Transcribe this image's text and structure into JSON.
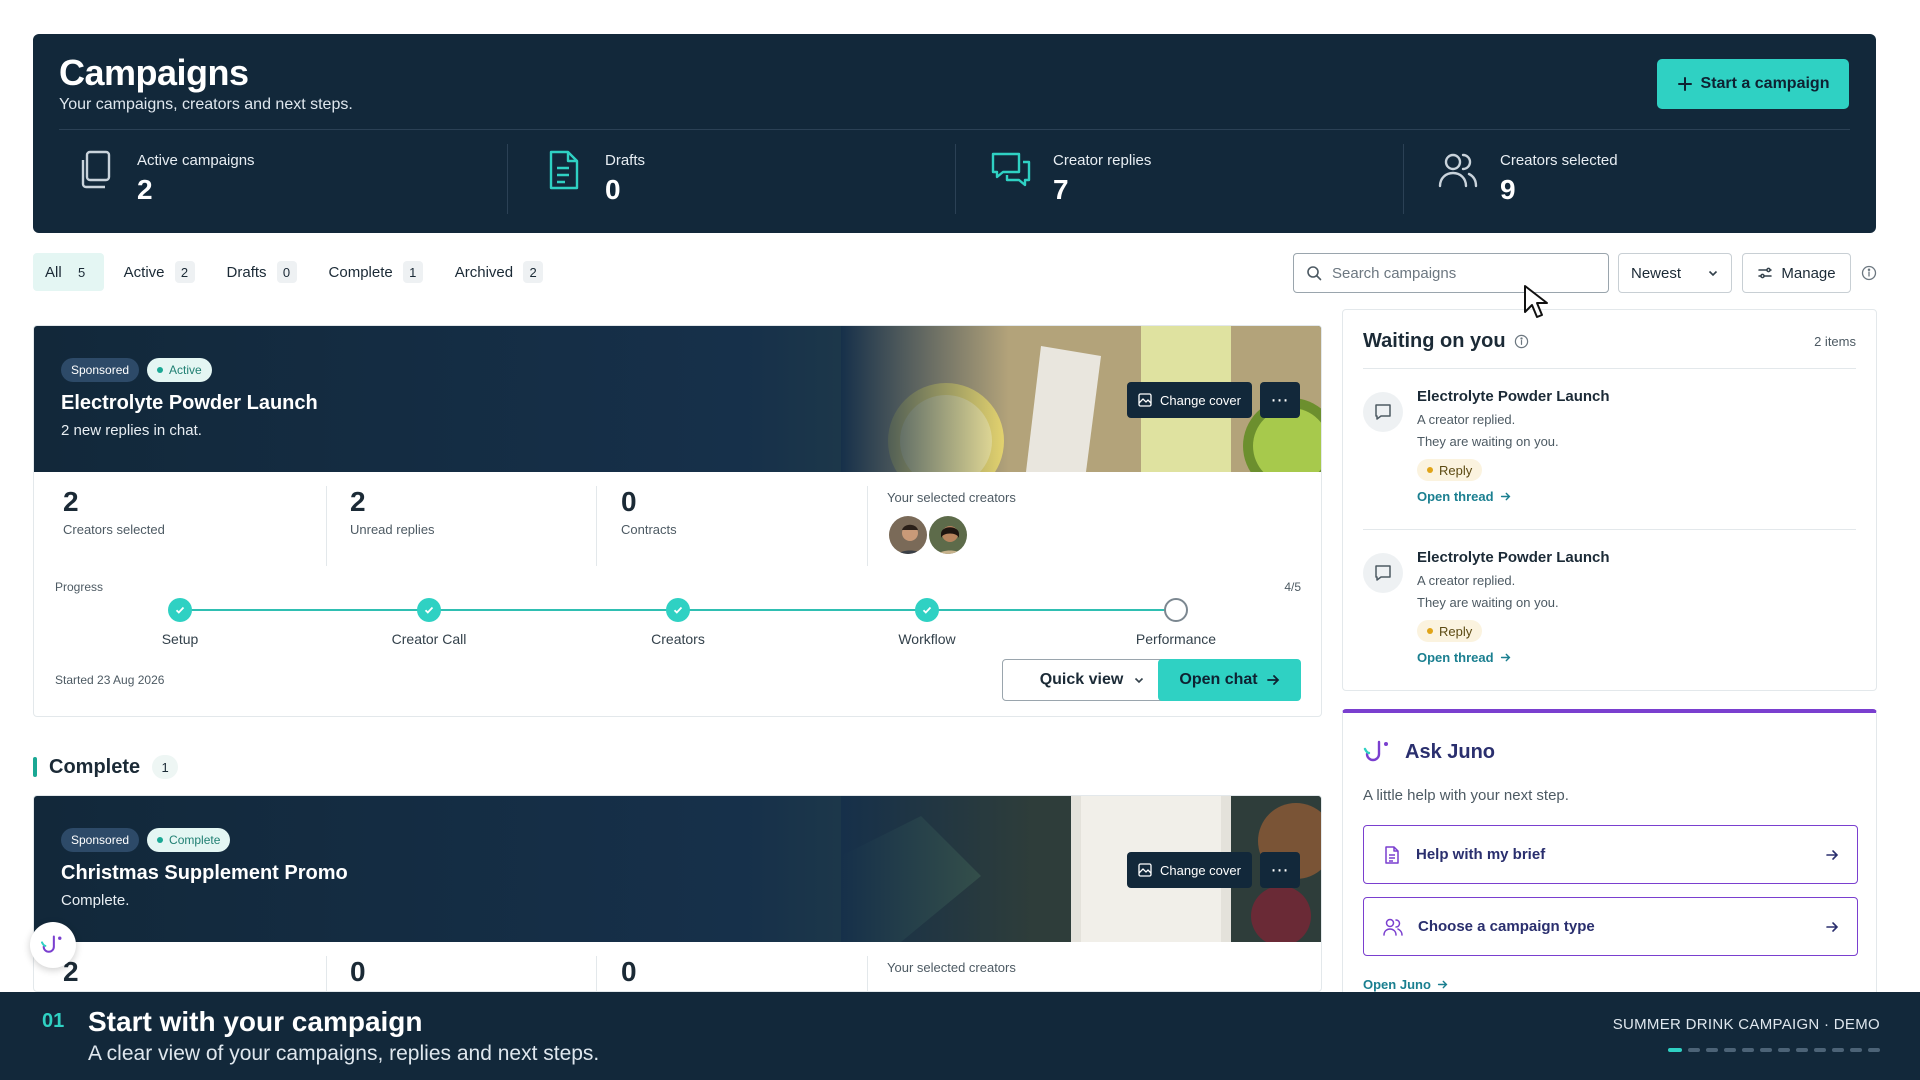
{
  "header": {
    "title": "Campaigns",
    "subtitle": "Your campaigns, creators and next steps.",
    "start_button": "Start a campaign",
    "stats": [
      {
        "label": "Active campaigns",
        "value": "2",
        "icon": "copy-icon"
      },
      {
        "label": "Drafts",
        "value": "0",
        "icon": "document-icon"
      },
      {
        "label": "Creator replies",
        "value": "7",
        "icon": "chat-icon"
      },
      {
        "label": "Creators selected",
        "value": "9",
        "icon": "users-icon"
      }
    ]
  },
  "filters": {
    "tabs": [
      {
        "label": "All",
        "count": "5",
        "active": true
      },
      {
        "label": "Active",
        "count": "2"
      },
      {
        "label": "Drafts",
        "count": "0"
      },
      {
        "label": "Complete",
        "count": "1"
      },
      {
        "label": "Archived",
        "count": "2"
      }
    ],
    "search_placeholder": "Search campaigns",
    "sort_value": "Newest",
    "manage_label": "Manage"
  },
  "campaigns": [
    {
      "sponsored_tag": "Sponsored",
      "status_tag": "Active",
      "title": "Electrolyte Powder Launch",
      "subtitle": "2 new replies in chat.",
      "change_cover": "Change cover",
      "metrics": [
        {
          "value": "2",
          "label": "Creators selected"
        },
        {
          "value": "2",
          "label": "Unread replies"
        },
        {
          "value": "0",
          "label": "Contracts"
        }
      ],
      "creators_label": "Your selected creators",
      "progress_label": "Progress",
      "progress_count": "4/5",
      "steps": [
        {
          "label": "Setup",
          "done": true
        },
        {
          "label": "Creator Call",
          "done": true
        },
        {
          "label": "Creators",
          "done": true
        },
        {
          "label": "Workflow",
          "done": true
        },
        {
          "label": "Performance",
          "done": false
        }
      ],
      "started": "Started 23 Aug 2026",
      "quick_view": "Quick view",
      "open_chat": "Open chat"
    },
    {
      "sponsored_tag": "Sponsored",
      "status_tag": "Complete",
      "title": "Christmas Supplement Promo",
      "subtitle": "Complete.",
      "change_cover": "Change cover",
      "metrics": [
        {
          "value": "2",
          "label": ""
        },
        {
          "value": "0",
          "label": ""
        },
        {
          "value": "0",
          "label": ""
        }
      ],
      "creators_label": "Your selected creators"
    }
  ],
  "complete_section": {
    "title": "Complete",
    "count": "1"
  },
  "waiting": {
    "title": "Waiting on you",
    "count": "2 items",
    "items": [
      {
        "title": "Electrolyte Powder Launch",
        "line1": "A creator replied.",
        "line2": "They are waiting on you.",
        "badge": "Reply",
        "link": "Open thread"
      },
      {
        "title": "Electrolyte Powder Launch",
        "line1": "A creator replied.",
        "line2": "They are waiting on you.",
        "badge": "Reply",
        "link": "Open thread"
      }
    ]
  },
  "juno": {
    "title": "Ask Juno",
    "subtitle": "A little help with your next step.",
    "options": [
      {
        "label": "Help with my brief",
        "icon": "document-icon"
      },
      {
        "label": "Choose a campaign type",
        "icon": "users-icon"
      }
    ],
    "open_link": "Open Juno"
  },
  "caption": {
    "number": "01",
    "title": "Start with your campaign",
    "subtitle": "A clear view of your campaigns, replies and next steps.",
    "right_label": "SUMMER DRINK CAMPAIGN · DEMO"
  },
  "colors": {
    "navy": "#12283a",
    "teal": "#2fd1c3",
    "purple": "#7a3fcf"
  }
}
